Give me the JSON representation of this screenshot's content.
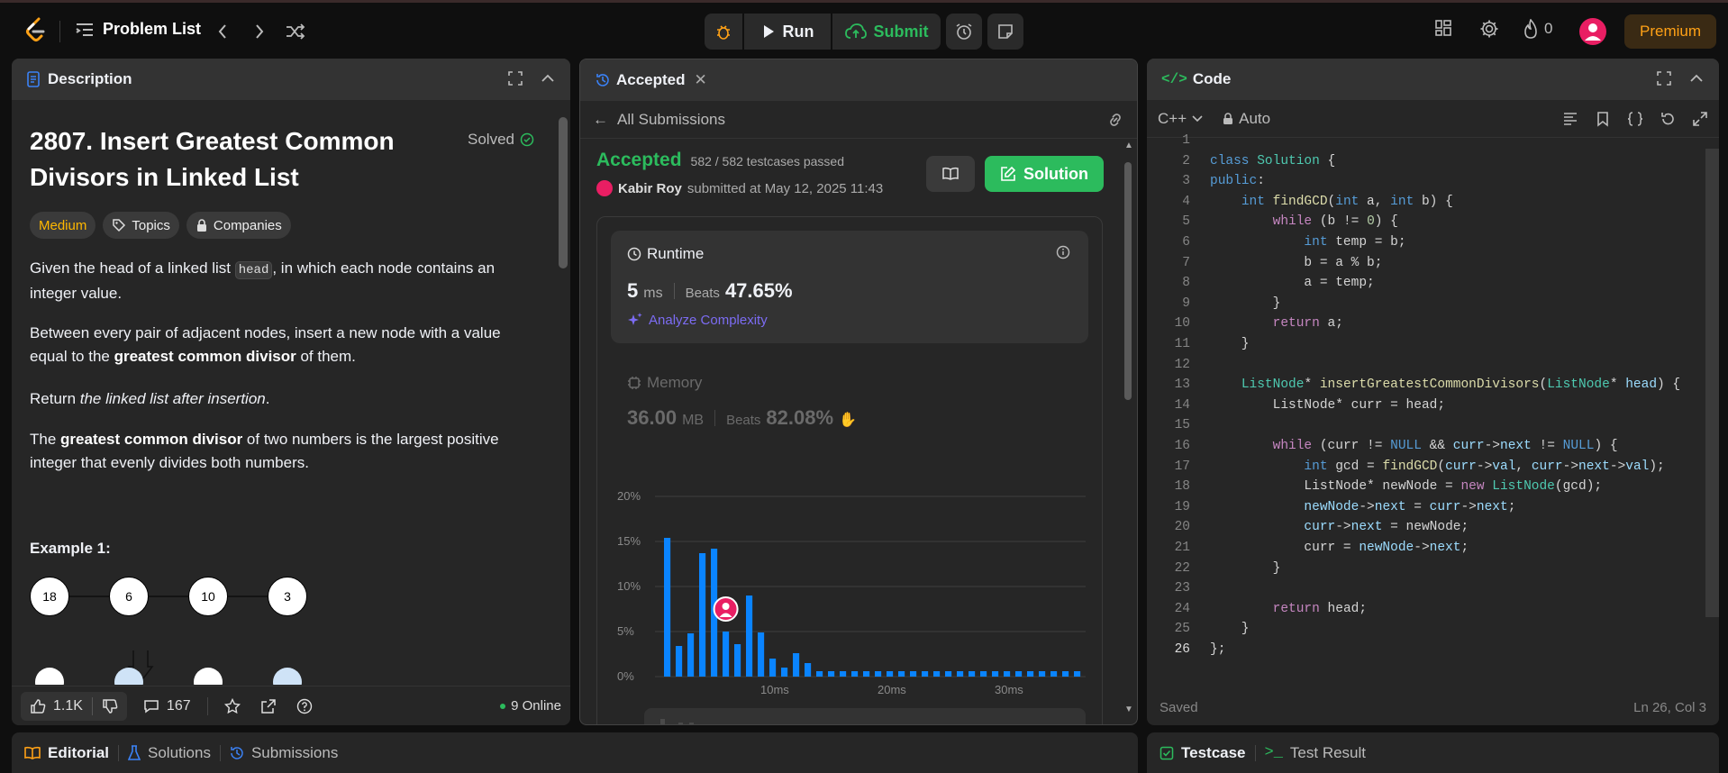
{
  "topbar": {
    "problem_list_label": "Problem List",
    "run_label": "Run",
    "submit_label": "Submit",
    "streak_count": "0",
    "premium_label": "Premium"
  },
  "description": {
    "tab_label": "Description",
    "title": "2807. Insert Greatest Common Divisors in Linked List",
    "solved_label": "Solved",
    "tags": [
      "Medium",
      "Topics",
      "Companies"
    ],
    "p1_a": "Given the head of a linked list ",
    "p1_code": "head",
    "p1_b": ", in which each node contains an integer value.",
    "p2_a": "Between every pair of adjacent nodes, insert a new node with a value equal to the ",
    "p2_bold": "greatest common divisor",
    "p2_b": " of them.",
    "p3_a": "Return ",
    "p3_em": "the linked list after insertion",
    "p3_b": ".",
    "p4_a": "The ",
    "p4_bold": "greatest common divisor",
    "p4_b": " of two numbers is the largest positive integer that evenly divides both numbers.",
    "example_label": "Example 1:",
    "nodes": [
      "18",
      "6",
      "10",
      "3"
    ],
    "likes": "1.1K",
    "comments": "167",
    "online": "9 Online"
  },
  "submission": {
    "tab_label": "Accepted",
    "all_submissions_label": "All Submissions",
    "status": "Accepted",
    "testcases": "582 / 582 testcases passed",
    "author": "Kabir Roy",
    "submitted_text": "submitted at May 12, 2025 11:43",
    "solution_label": "Solution",
    "runtime_label": "Runtime",
    "runtime_value": "5",
    "runtime_unit": "ms",
    "beats_label": "Beats",
    "runtime_beats": "47.65%",
    "analyze_label": "Analyze Complexity",
    "memory_label": "Memory",
    "memory_value": "36.00",
    "memory_unit": "MB",
    "memory_beats": "82.08%"
  },
  "chart_data": {
    "type": "bar",
    "title": "",
    "xlabel": "",
    "ylabel": "",
    "y_ticks": [
      "20%",
      "15%",
      "10%",
      "5%",
      "0%"
    ],
    "x_ticks": [
      "10ms",
      "20ms",
      "30ms"
    ],
    "ylim": [
      0,
      20
    ],
    "x": [
      1,
      2,
      3,
      4,
      5,
      6,
      7,
      8,
      9,
      10,
      11,
      12,
      13,
      14,
      15,
      16,
      17,
      18,
      19,
      20,
      21,
      22,
      23,
      24,
      25,
      26,
      27,
      28,
      29,
      30,
      31,
      32,
      33,
      34,
      35,
      36
    ],
    "values": [
      15.4,
      3.4,
      4.8,
      13.7,
      14.2,
      5.0,
      3.6,
      9.0,
      4.9,
      2.0,
      1.0,
      2.6,
      1.5,
      0.6,
      0.6,
      0.6,
      0.6,
      0.6,
      0.6,
      0.6,
      0.6,
      0.6,
      0.6,
      0.6,
      0.6,
      0.6,
      0.6,
      0.6,
      0.6,
      0.6,
      0.6,
      0.6,
      0.6,
      0.6,
      0.6,
      0.6
    ],
    "bar_color": "#0a84ff",
    "grid": true,
    "user_marker_x": 6
  },
  "code": {
    "tab_label": "Code",
    "language": "C++",
    "mode": "Auto",
    "saved_label": "Saved",
    "cursor_pos": "Ln 26, Col 3"
  },
  "bottom": {
    "editorial": "Editorial",
    "solutions": "Solutions",
    "submissions": "Submissions",
    "testcase": "Testcase",
    "test_result": "Test Result"
  }
}
